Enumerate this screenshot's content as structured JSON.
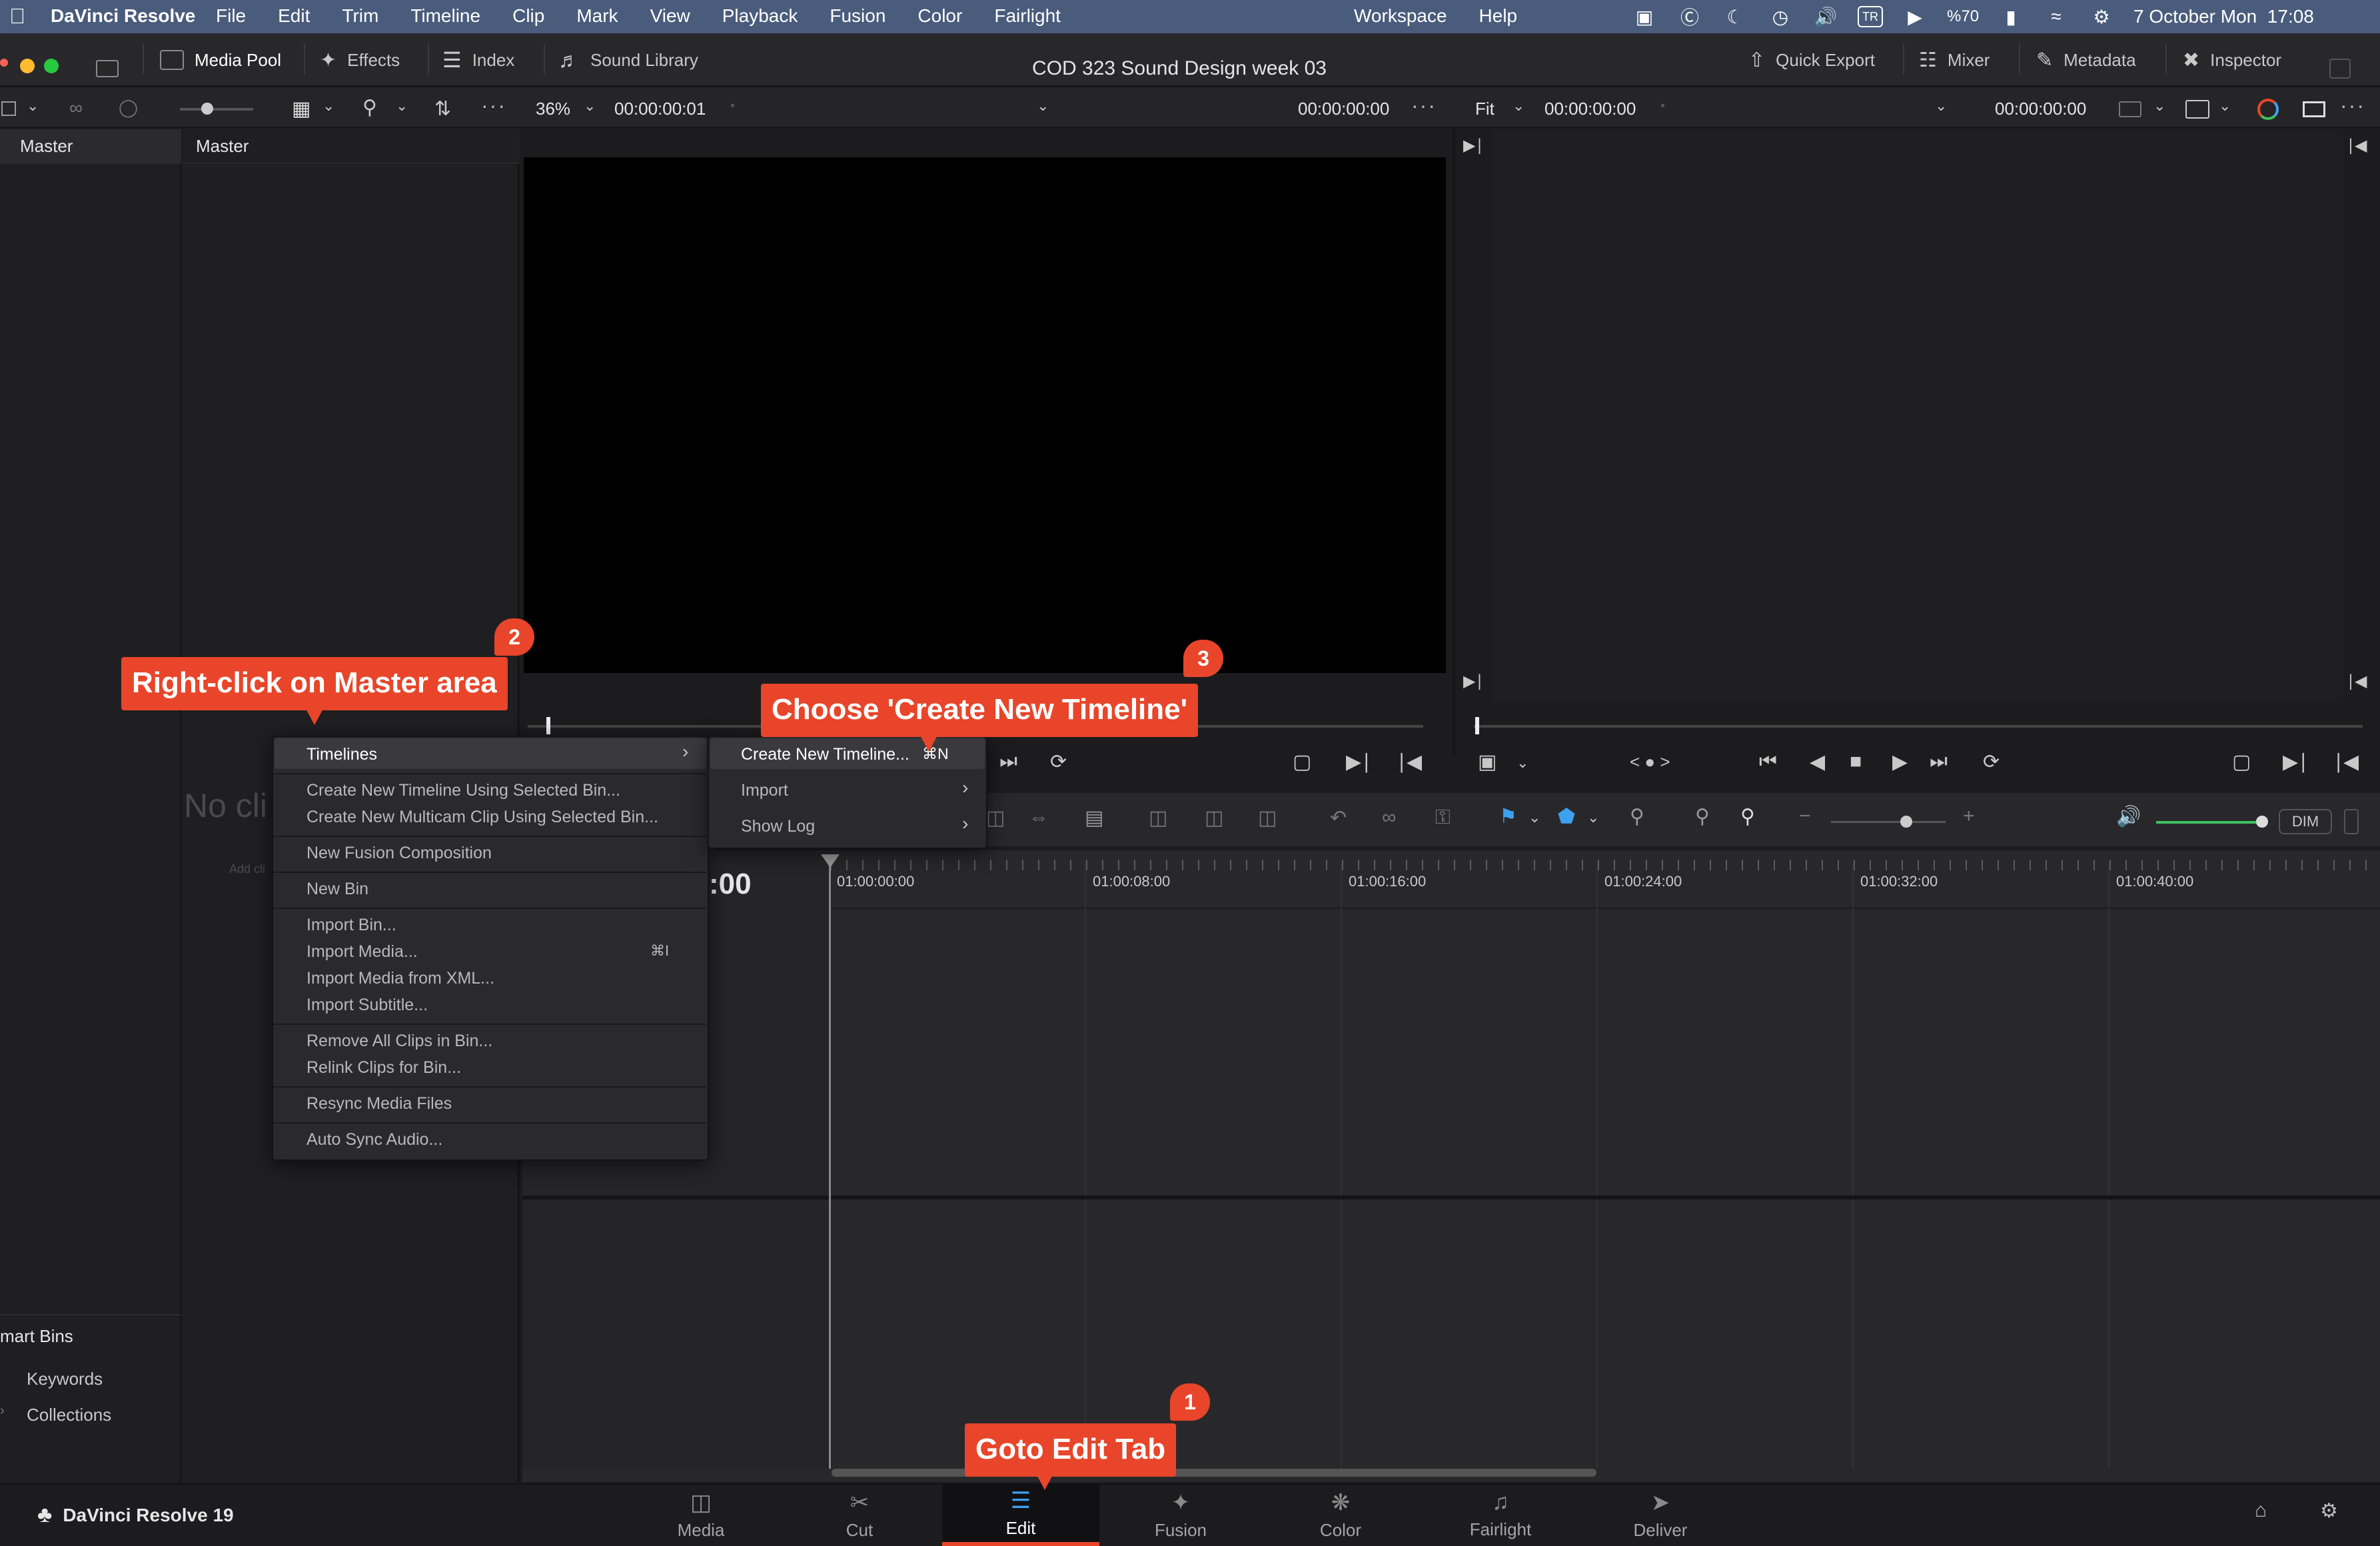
{
  "menubar": {
    "app_name": "DaVinci Resolve",
    "items": [
      "File",
      "Edit",
      "Trim",
      "Timeline",
      "Clip",
      "Mark",
      "View",
      "Playback",
      "Fusion",
      "Color",
      "Fairlight"
    ],
    "right_items": [
      "Workspace",
      "Help"
    ],
    "battery": "%70",
    "input_source": "TR",
    "datetime": "7 October Mon  17:08"
  },
  "toolbar": {
    "media_pool": "Media Pool",
    "effects": "Effects",
    "index": "Index",
    "sound_library": "Sound Library",
    "project_title": "COD 323 Sound Design week 03",
    "quick_export": "Quick Export",
    "mixer": "Mixer",
    "metadata": "Metadata",
    "inspector": "Inspector"
  },
  "viewer_bar": {
    "zoom": "36%",
    "source_timecode": "00:00:00:01",
    "source_duration": "00:00:00:00",
    "fit": "Fit",
    "timeline_timecode": "00:00:00:00",
    "timeline_duration": "00:00:00:00"
  },
  "bins": {
    "header": "Master",
    "media_header": "Master",
    "no_clips_partial": "No cli",
    "add_clips_partial": "Add cli"
  },
  "smart_bins": {
    "title": "mart Bins",
    "items": [
      "Keywords",
      "Collections"
    ]
  },
  "context_menu": {
    "items": [
      {
        "label": "Timelines",
        "submenu": true
      },
      {
        "label": "Create New Timeline Using Selected Bin..."
      },
      {
        "label": "Create New Multicam Clip Using Selected Bin..."
      },
      {
        "label": "New Fusion Composition"
      },
      {
        "label": "New Bin"
      },
      {
        "label": "Import Bin..."
      },
      {
        "label": "Import Media...",
        "shortcut": "⌘I"
      },
      {
        "label": "Import Media from XML..."
      },
      {
        "label": "Import Subtitle..."
      },
      {
        "label": "Remove All Clips in Bin..."
      },
      {
        "label": "Relink Clips for Bin..."
      },
      {
        "label": "Resync Media Files"
      },
      {
        "label": "Auto Sync Audio..."
      }
    ]
  },
  "submenu": {
    "items": [
      {
        "label": "Create New Timeline...",
        "shortcut": "⌘N"
      },
      {
        "label": "Import"
      },
      {
        "label": "Show Log"
      }
    ]
  },
  "timeline": {
    "timecode_partial": ":00",
    "ruler": [
      "01:00:00:00",
      "01:00:08:00",
      "01:00:16:00",
      "01:00:24:00",
      "01:00:32:00",
      "01:00:40:00"
    ],
    "dim": "DIM"
  },
  "pages": {
    "brand": "DaVinci Resolve 19",
    "tabs": [
      "Media",
      "Cut",
      "Edit",
      "Fusion",
      "Color",
      "Fairlight",
      "Deliver"
    ],
    "active": "Edit"
  },
  "callouts": {
    "step1": "Goto Edit Tab",
    "step2": "Right-click on Master area",
    "step3": "Choose 'Create New Timeline'",
    "badge1": "1",
    "badge2": "2",
    "badge3": "3"
  },
  "colors": {
    "accent": "#e8452a",
    "menubar": "#4a5c7c",
    "panel": "#28282b"
  }
}
